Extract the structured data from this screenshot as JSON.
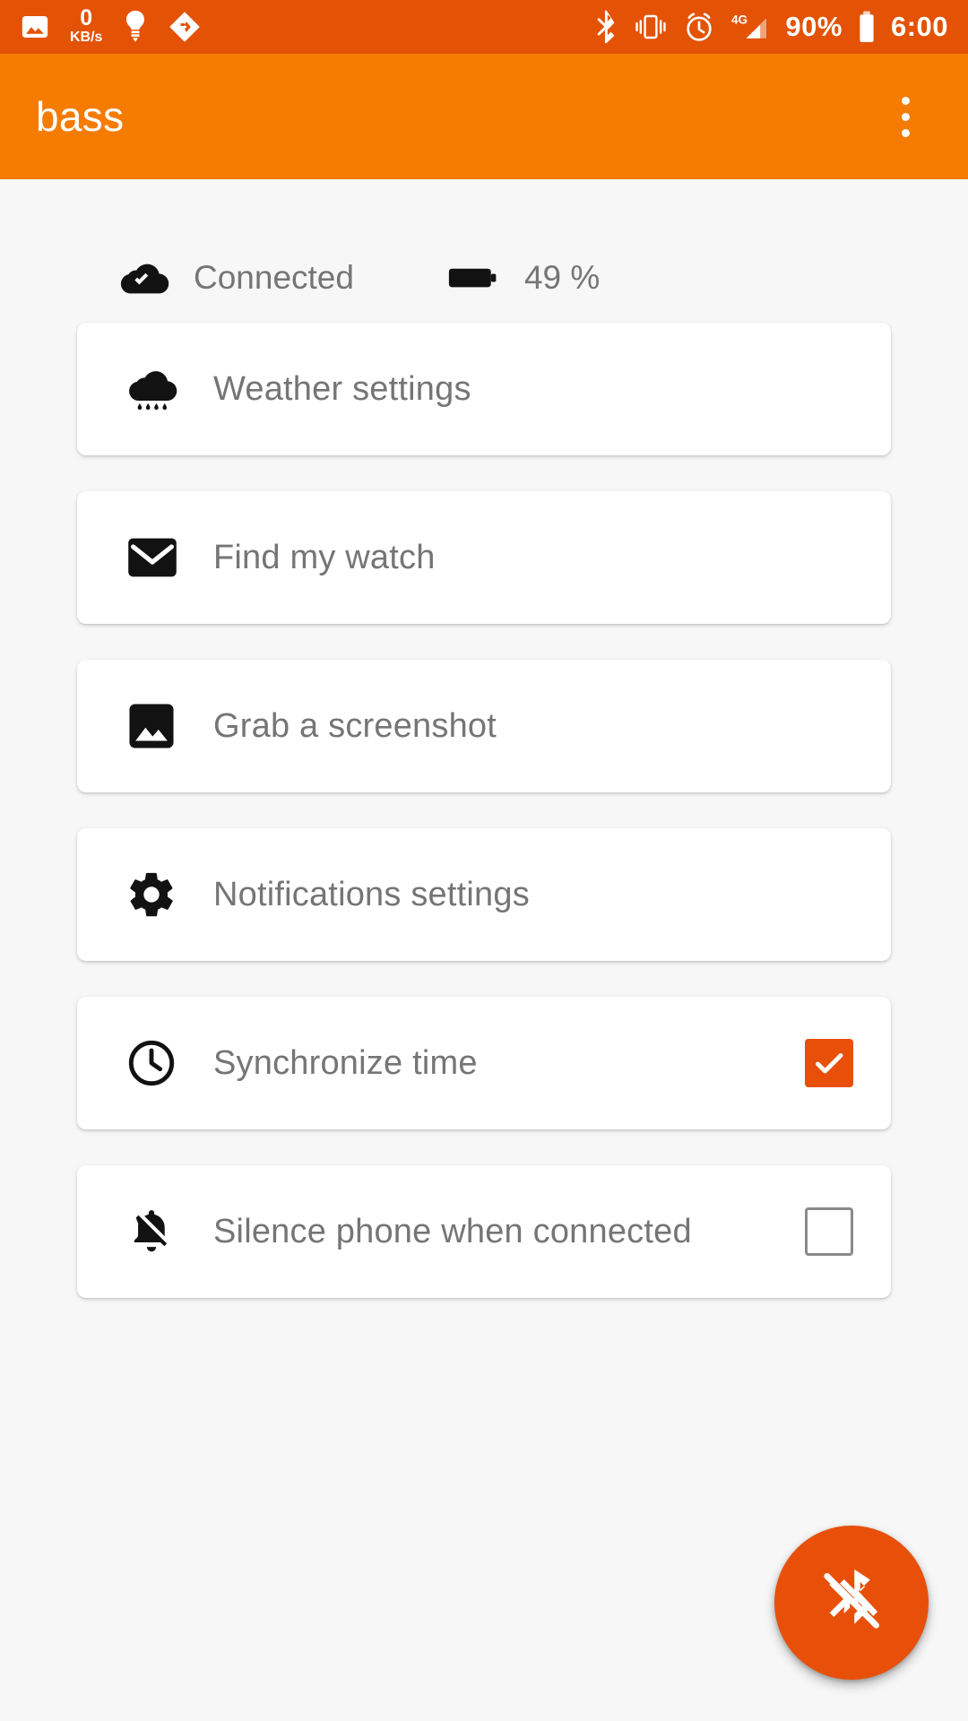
{
  "statusbar": {
    "network_speed_value": "0",
    "network_speed_unit": "KB/s",
    "battery_percent": "90%",
    "clock": "6:00",
    "left_icons": [
      "photo-icon",
      "network-speed-indicator",
      "lightbulb-icon",
      "diamond-app-icon"
    ],
    "right_icons": [
      "bluetooth-icon",
      "vibrate-icon",
      "alarm-clock-icon",
      "signal-4g-icon",
      "battery-icon"
    ],
    "background_color": "#E35205"
  },
  "appbar": {
    "title": "bass",
    "overflow_menu": "overflow-menu-icon",
    "background_color": "#F57C00"
  },
  "status_row": {
    "connection_icon": "cloud-check-icon",
    "connection_label": "Connected",
    "battery_icon": "battery-horizontal-icon",
    "battery_label": "49 %"
  },
  "cards": [
    {
      "icon": "rain-cloud-icon",
      "label": "Weather settings",
      "has_checkbox": false,
      "checked": false
    },
    {
      "icon": "envelope-icon",
      "label": "Find my watch",
      "has_checkbox": false,
      "checked": false
    },
    {
      "icon": "image-icon",
      "label": "Grab a screenshot",
      "has_checkbox": false,
      "checked": false
    },
    {
      "icon": "gear-icon",
      "label": "Notifications settings",
      "has_checkbox": false,
      "checked": false
    },
    {
      "icon": "clock-icon",
      "label": "Synchronize time",
      "has_checkbox": true,
      "checked": true
    },
    {
      "icon": "bell-off-icon",
      "label": "Silence phone when connected",
      "has_checkbox": true,
      "checked": false
    }
  ],
  "fab": {
    "icon": "bluetooth-disabled-icon",
    "color": "#E8500A"
  },
  "colors": {
    "status_bar": "#E35205",
    "app_bar": "#F57C00",
    "accent": "#E8500A",
    "page_background": "#F7F7F7",
    "card_background": "#FFFFFF",
    "label_text": "#757575"
  }
}
